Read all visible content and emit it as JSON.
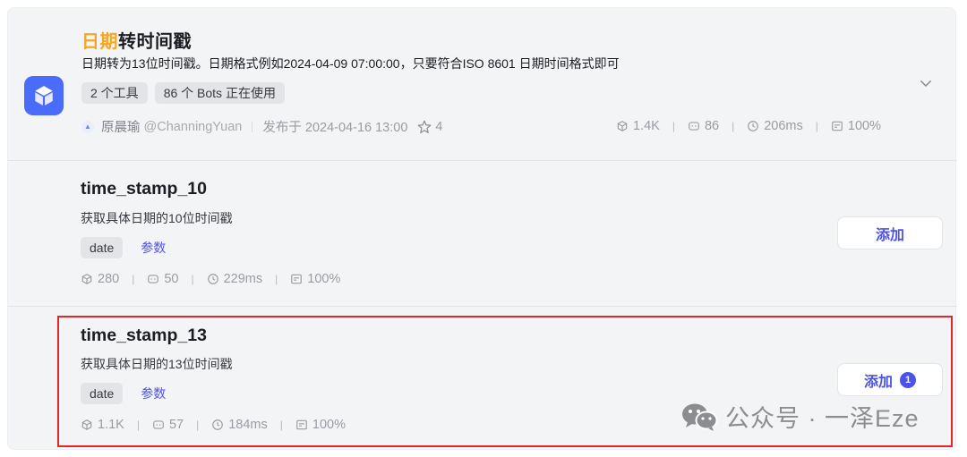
{
  "plugin": {
    "title_highlight": "日期",
    "title_rest": "转时间戳",
    "description": "日期转为13位时间戳。日期格式例如2024-04-09 07:00:00，只要符合ISO 8601 日期时间格式即可",
    "chips": [
      "2 个工具",
      "86 个 Bots 正在使用"
    ],
    "author_name": "原晨瑜",
    "author_handle": "@ChanningYuan",
    "published": "发布于 2024-04-16 13:00",
    "stars": "4",
    "stats": {
      "bots": "1.4K",
      "calls": "86",
      "latency": "206ms",
      "success": "100%"
    }
  },
  "tools": [
    {
      "name": "time_stamp_10",
      "description": "获取具体日期的10位时间戳",
      "tag": "date",
      "params_label": "参数",
      "stats": {
        "bots": "280",
        "calls": "50",
        "latency": "229ms",
        "success": "100%"
      },
      "add_label": "添加"
    },
    {
      "name": "time_stamp_13",
      "description": "获取具体日期的13位时间戳",
      "tag": "date",
      "params_label": "参数",
      "stats": {
        "bots": "1.1K",
        "calls": "57",
        "latency": "184ms",
        "success": "100%"
      },
      "add_label": "添加",
      "badge": "1"
    }
  ],
  "watermark": "公众号 · 一泽Eze",
  "colors": {
    "accent": "#4d53e8",
    "title_highlight": "#f5a623",
    "highlight_box": "#e3262a"
  }
}
